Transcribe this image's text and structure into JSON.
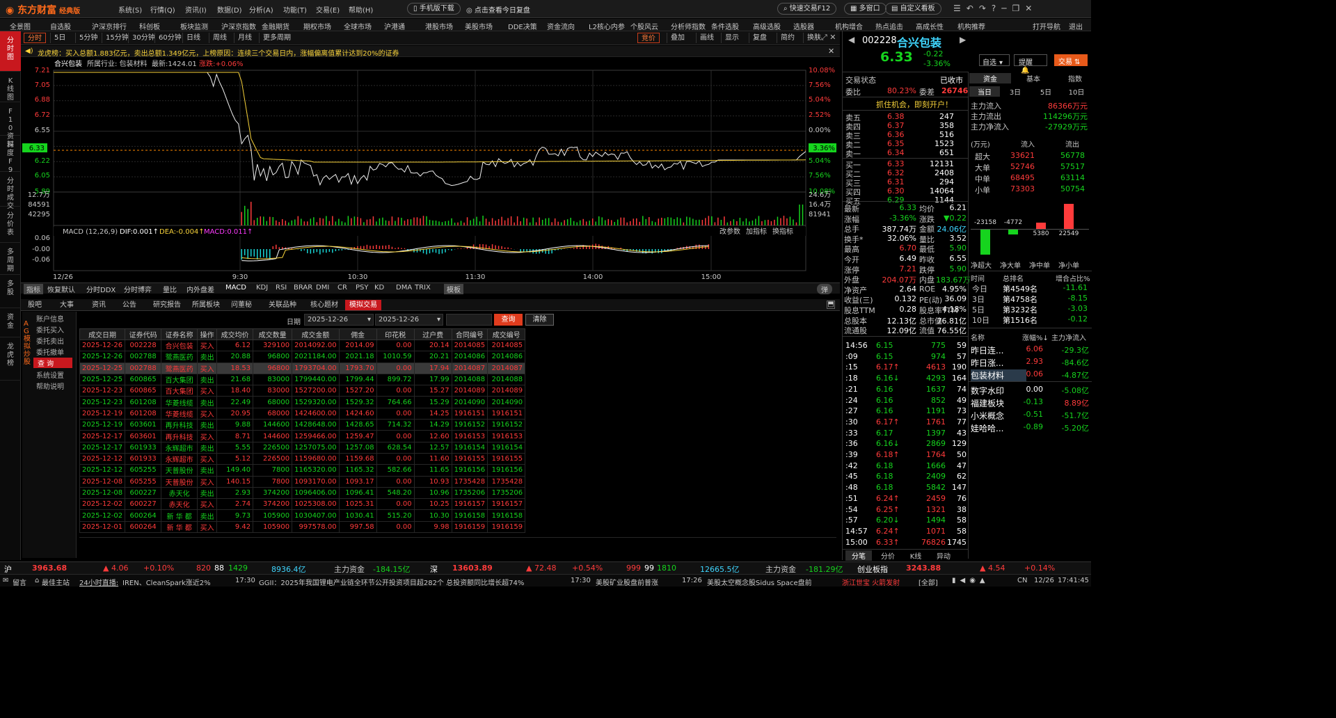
{
  "app": {
    "logo": "东方财富",
    "edition": "经典版",
    "menus": [
      "系统(S)",
      "行情(Q)",
      "资讯(I)",
      "数据(D)",
      "分析(A)",
      "功能(T)",
      "交易(E)",
      "帮助(H)"
    ],
    "mobile_btn": "手机版下载",
    "review_btn": "点击查看今日复盘",
    "quick_trade": "快速交易F12",
    "multiwindow": "多窗口",
    "custom_board": "自定义看板"
  },
  "navbar": [
    "全景图",
    "自选股",
    "沪深京排行",
    "科创板",
    "板块监测",
    "沪深京指数",
    "金融期货",
    "期权市场",
    "全球市场",
    "沪港通",
    "港股市场",
    "美股市场",
    "DDE决策",
    "资金流向",
    "L2核心内参",
    "个股风云",
    "分析师指数",
    "条件选股",
    "高级选股",
    "选股器",
    "机构增合",
    "热点追击",
    "高成长性",
    "机构推荐",
    "打开导航",
    "退出"
  ],
  "left_tabs": [
    "分时图",
    "K线图",
    "F10资料",
    "深度F9",
    "分时成交",
    "分价表",
    "多周期",
    "多股",
    "资金",
    "龙虎榜"
  ],
  "period_tabs": [
    "分时",
    "5日",
    "5分钟",
    "15分钟",
    "30分钟",
    "60分钟",
    "日线",
    "周线",
    "月线",
    "更多周期"
  ],
  "period_right": [
    "竞价",
    "叠加",
    "画线",
    "显示",
    "复盘",
    "简约",
    "换肤"
  ],
  "dragon": "龙虎榜：买入总额1.883亿元，卖出总额1.349亿元，上榜原因：连续三个交易日内，涨幅偏离值累计达到20%的证券",
  "chart_header": {
    "name": "合兴包装",
    "industry": "所属行业: 包装材料",
    "latest": "最新:1424.01",
    "change": "涨跌:+0.06%"
  },
  "price_axis": {
    "left": [
      "7.21",
      "7.05",
      "6.88",
      "6.72",
      "6.55",
      "6.33",
      "6.22",
      "6.05",
      "5.89"
    ],
    "right": [
      "10.08%",
      "7.56%",
      "5.04%",
      "2.52%",
      "0.00%",
      "3.36%",
      "5.04%",
      "7.56%",
      "10.08%"
    ]
  },
  "vol_axis": {
    "left": [
      "12.7万",
      "84591",
      "42295"
    ],
    "right": [
      "24.6万",
      "16.4万",
      "81941"
    ]
  },
  "macd": {
    "label": "MACD (12,26,9)",
    "dif": "DIF:0.001↑",
    "dea": "DEA:-0.004↑",
    "macd": "MACD:0.011↑",
    "axis": [
      "0.06",
      "-0.00",
      "-0.06"
    ],
    "links": [
      "改参数",
      "加指标",
      "换指标"
    ]
  },
  "time_axis": [
    "12/26",
    "9:30",
    "10:30",
    "11:30",
    "14:00",
    "15:00"
  ],
  "ind_tabs": [
    "指标",
    "恢复默认",
    "分时DDX",
    "分时博弈",
    "量比",
    "内外盘差",
    "MACD",
    "KDJ",
    "RSI",
    "BRAR",
    "DMI",
    "CR",
    "PSY",
    "KD",
    "DMA",
    "TRIX",
    "模板",
    "弹"
  ],
  "bottom_tabs": [
    "股吧",
    "大事",
    "资讯",
    "公告",
    "研究报告",
    "所属板块",
    "问董秘",
    "关联品种",
    "核心题材",
    "模拟交易"
  ],
  "trade_side": {
    "vertical": "AG模拟炒股",
    "items": [
      "账户信息",
      "委托买入",
      "委托卖出",
      "委托撤单",
      "查 询",
      "系统设置",
      "帮助说明"
    ]
  },
  "filter": {
    "label": "日期",
    "from": "2025-12-26",
    "to": "2025-12-26",
    "query": "查询",
    "clear": "清除"
  },
  "trade_headers": [
    "成交日期",
    "证券代码",
    "证券名称",
    "操作",
    "成交均价",
    "成交数量",
    "成交金额",
    "佣金",
    "印花税",
    "过户费",
    "合同编号",
    "成交编号"
  ],
  "trades": [
    [
      "2025-12-26",
      "002228",
      "合兴包装",
      "买入",
      "6.12",
      "329100",
      "2014092.00",
      "2014.09",
      "0.00",
      "20.14",
      "2014085",
      "2014085"
    ],
    [
      "2025-12-26",
      "002788",
      "鹭燕医药",
      "卖出",
      "20.88",
      "96800",
      "2021184.00",
      "2021.18",
      "1010.59",
      "20.21",
      "2014086",
      "2014086"
    ],
    [
      "2025-12-25",
      "002788",
      "鹭燕医药",
      "买入",
      "18.53",
      "96800",
      "1793704.00",
      "1793.70",
      "0.00",
      "17.94",
      "2014087",
      "2014087"
    ],
    [
      "2025-12-25",
      "600865",
      "百大集团",
      "卖出",
      "21.68",
      "83000",
      "1799440.00",
      "1799.44",
      "899.72",
      "17.99",
      "2014088",
      "2014088"
    ],
    [
      "2025-12-23",
      "600865",
      "百大集团",
      "买入",
      "18.40",
      "83000",
      "1527200.00",
      "1527.20",
      "0.00",
      "15.27",
      "2014089",
      "2014089"
    ],
    [
      "2025-12-23",
      "601208",
      "华菱线缆",
      "卖出",
      "22.49",
      "68000",
      "1529320.00",
      "1529.32",
      "764.66",
      "15.29",
      "2014090",
      "2014090"
    ],
    [
      "2025-12-19",
      "601208",
      "华菱线缆",
      "买入",
      "20.95",
      "68000",
      "1424600.00",
      "1424.60",
      "0.00",
      "14.25",
      "1916151",
      "1916151"
    ],
    [
      "2025-12-19",
      "603601",
      "再升科技",
      "卖出",
      "9.88",
      "144600",
      "1428648.00",
      "1428.65",
      "714.32",
      "14.29",
      "1916152",
      "1916152"
    ],
    [
      "2025-12-17",
      "603601",
      "再升科技",
      "买入",
      "8.71",
      "144600",
      "1259466.00",
      "1259.47",
      "0.00",
      "12.60",
      "1916153",
      "1916153"
    ],
    [
      "2025-12-17",
      "601933",
      "永辉超市",
      "卖出",
      "5.55",
      "226500",
      "1257075.00",
      "1257.08",
      "628.54",
      "12.57",
      "1916154",
      "1916154"
    ],
    [
      "2025-12-12",
      "601933",
      "永辉超市",
      "买入",
      "5.12",
      "226500",
      "1159680.00",
      "1159.68",
      "0.00",
      "11.60",
      "1916155",
      "1916155"
    ],
    [
      "2025-12-12",
      "605255",
      "天普股份",
      "卖出",
      "149.40",
      "7800",
      "1165320.00",
      "1165.32",
      "582.66",
      "11.65",
      "1916156",
      "1916156"
    ],
    [
      "2025-12-08",
      "605255",
      "天普股份",
      "买入",
      "140.15",
      "7800",
      "1093170.00",
      "1093.17",
      "0.00",
      "10.93",
      "1735428",
      "1735428"
    ],
    [
      "2025-12-08",
      "600227",
      "赤天化",
      "卖出",
      "2.93",
      "374200",
      "1096406.00",
      "1096.41",
      "548.20",
      "10.96",
      "1735206",
      "1735206"
    ],
    [
      "2025-12-02",
      "600227",
      "赤天化",
      "买入",
      "2.74",
      "374200",
      "1025308.00",
      "1025.31",
      "0.00",
      "10.25",
      "1916157",
      "1916157"
    ],
    [
      "2025-12-02",
      "600264",
      "新 华 都",
      "卖出",
      "9.73",
      "105900",
      "1030407.00",
      "1030.41",
      "515.20",
      "10.30",
      "1916158",
      "1916158"
    ],
    [
      "2025-12-01",
      "600264",
      "新 华 都",
      "买入",
      "9.42",
      "105900",
      "997578.00",
      "997.58",
      "0.00",
      "9.98",
      "1916159",
      "1916159"
    ]
  ],
  "stock": {
    "code": "002228",
    "name": "合兴包装",
    "price": "6.33",
    "chg": "-0.22",
    "pct": "-3.36%",
    "zixuan": "自选",
    "tixing": "提醒",
    "jiaoyi": "交易"
  },
  "status": {
    "label": "交易状态",
    "value": "已收市",
    "weibi_l": "委比",
    "weibi": "80.23%",
    "weicha_l": "委差",
    "weicha": "26746",
    "promo": "抓住机会，即刻开户！"
  },
  "asks": [
    [
      "卖五",
      "6.38",
      "247"
    ],
    [
      "卖四",
      "6.37",
      "358"
    ],
    [
      "卖三",
      "6.36",
      "516"
    ],
    [
      "卖二",
      "6.35",
      "1523"
    ],
    [
      "卖一",
      "6.34",
      "651"
    ]
  ],
  "bids": [
    [
      "买一",
      "6.33",
      "12131"
    ],
    [
      "买二",
      "6.32",
      "2408"
    ],
    [
      "买三",
      "6.31",
      "294"
    ],
    [
      "买四",
      "6.30",
      "14064"
    ],
    [
      "买五",
      "6.29",
      "1144"
    ]
  ],
  "quote": [
    [
      "最新",
      "6.33",
      "均价",
      "6.21"
    ],
    [
      "涨幅",
      "-3.36%",
      "涨跌",
      "▼0.22"
    ],
    [
      "总手",
      "387.74万",
      "金额",
      "24.06亿"
    ],
    [
      "换手*",
      "32.06%",
      "量比",
      "3.52"
    ],
    [
      "最高",
      "6.70",
      "最低",
      "5.90"
    ],
    [
      "今开",
      "6.49",
      "昨收",
      "6.55"
    ],
    [
      "涨停",
      "7.21",
      "跌停",
      "5.90"
    ],
    [
      "外盘",
      "204.07万",
      "内盘",
      "183.67万"
    ],
    [
      "净资产",
      "2.64",
      "ROE",
      "4.95%"
    ],
    [
      "收益(三)",
      "0.132",
      "PE(动)",
      "36.09"
    ],
    [
      "股息TTM",
      "0.28",
      "股息率TTM",
      "4.18%"
    ],
    [
      "总股本",
      "12.13亿",
      "总市值",
      "76.81亿"
    ],
    [
      "流通股",
      "12.09亿",
      "流值",
      "76.55亿"
    ]
  ],
  "fund_tabs": [
    "资金",
    "基本",
    "指数"
  ],
  "fund_subtabs": [
    "当日",
    "3日",
    "5日",
    "10日"
  ],
  "fund_flow": [
    [
      "主力流入",
      "86366万元"
    ],
    [
      "主力流出",
      "114296万元"
    ],
    [
      "主力净流入",
      "-27929万元"
    ]
  ],
  "fund_table_header": [
    "(万元)",
    "流入",
    "流出"
  ],
  "fund_table": [
    [
      "超大",
      "33621",
      "56778"
    ],
    [
      "大单",
      "52746",
      "57517"
    ],
    [
      "中单",
      "68495",
      "63114"
    ],
    [
      "小单",
      "73303",
      "50754"
    ]
  ],
  "fund_bars": {
    "labels": [
      "净超大",
      "净大单",
      "净中单",
      "净小单"
    ],
    "values": [
      -23158,
      -4772,
      5380,
      22549
    ]
  },
  "rank_header": [
    "时间",
    "总排名",
    "增合占比%"
  ],
  "rank": [
    [
      "今日",
      "第4549名",
      "-11.61"
    ],
    [
      "3日",
      "第4758名",
      "-8.15"
    ],
    [
      "5日",
      "第3232名",
      "-3.03"
    ],
    [
      "10日",
      "第1516名",
      "-0.12"
    ]
  ],
  "ticks": [
    [
      "14:56",
      "6.15",
      "775",
      "59"
    ],
    [
      ":09",
      "6.15",
      "974",
      "57"
    ],
    [
      ":15",
      "6.17↑",
      "4613",
      "190"
    ],
    [
      ":18",
      "6.16↓",
      "4293",
      "164"
    ],
    [
      ":21",
      "6.16",
      "1637",
      "74"
    ],
    [
      ":24",
      "6.16",
      "852",
      "49"
    ],
    [
      ":27",
      "6.16",
      "1191",
      "73"
    ],
    [
      ":30",
      "6.17↑",
      "1761",
      "77"
    ],
    [
      ":33",
      "6.17",
      "1397",
      "43"
    ],
    [
      ":36",
      "6.16↓",
      "2869",
      "129"
    ],
    [
      ":39",
      "6.18↑",
      "1764",
      "50"
    ],
    [
      ":42",
      "6.18",
      "1666",
      "47"
    ],
    [
      ":45",
      "6.18",
      "2409",
      "62"
    ],
    [
      ":48",
      "6.18",
      "5842",
      "147"
    ],
    [
      ":51",
      "6.24↑",
      "2459",
      "76"
    ],
    [
      ":54",
      "6.25↑",
      "1321",
      "38"
    ],
    [
      ":57",
      "6.20↓",
      "1494",
      "58"
    ],
    [
      "14:57",
      "6.24↑",
      "1071",
      "58"
    ],
    [
      "15:00",
      "6.33↑",
      "76826",
      "1745"
    ]
  ],
  "tick_tabs": [
    "分笔",
    "分价",
    "K线",
    "异动"
  ],
  "sectors_header": [
    "名称",
    "涨幅%↓",
    "主力净流入"
  ],
  "sectors": [
    [
      "昨日连...",
      "6.06",
      "-29.3亿"
    ],
    [
      "昨日涨...",
      "2.93",
      "-84.6亿"
    ],
    [
      "包装材料",
      "0.06",
      "-4.87亿"
    ],
    [
      "数字水印",
      "0.00",
      "-5.08亿"
    ],
    [
      "福建板块",
      "-0.13",
      "8.89亿"
    ],
    [
      "小米概念",
      "-0.51",
      "-51.7亿"
    ],
    [
      "娃哈哈...",
      "-0.89",
      "-5.20亿"
    ]
  ],
  "statusbar": {
    "sh": "沪",
    "sh_idx": "3963.68",
    "sh_chg": "▲ 4.06",
    "sh_pct": "+0.10%",
    "sh_up": "820",
    "sh_flat": "88",
    "sh_dn": "1429",
    "sh_amt": "8936.4亿",
    "sh_fund_l": "主力资金",
    "sh_fund": "-184.15亿",
    "sz": "深",
    "sz_idx": "13603.89",
    "sz_chg": "▲ 72.48",
    "sz_pct": "+0.54%",
    "sz_up": "999",
    "sz_flat": "99",
    "sz_dn": "1810",
    "sz_amt": "12665.5亿",
    "sz_fund_l": "主力资金",
    "sz_fund": "-181.29亿",
    "cy": "创业板指",
    "cy_idx": "3243.88",
    "cy_chg": "▲ 4.54",
    "cy_pct": "+0.14%"
  },
  "ticker": {
    "t1": "留言",
    "t2": "最佳主站",
    "t3": "24小时直播: ",
    "n1": "IREN、CleanSpark涨近2%",
    "n2_t": "17:30",
    "n2": "GGII：2025年我国锂电产业链全环节公开投资项目超282个 总投资额同比增长超74%",
    "n3_t": "17:30",
    "n3": "美股矿业股盘前普涨",
    "n4_t": "17:26",
    "n4": "美股太空概念股Sidus Space盘前",
    "n5": "浙江世宝 火箭发射",
    "all": "[全部]",
    "lang": "CN",
    "date": "12/26",
    "time": "17:41:45"
  },
  "colors": {
    "up": "#ff3b3b",
    "down": "#16d41e",
    "accent": "#c8181e"
  }
}
